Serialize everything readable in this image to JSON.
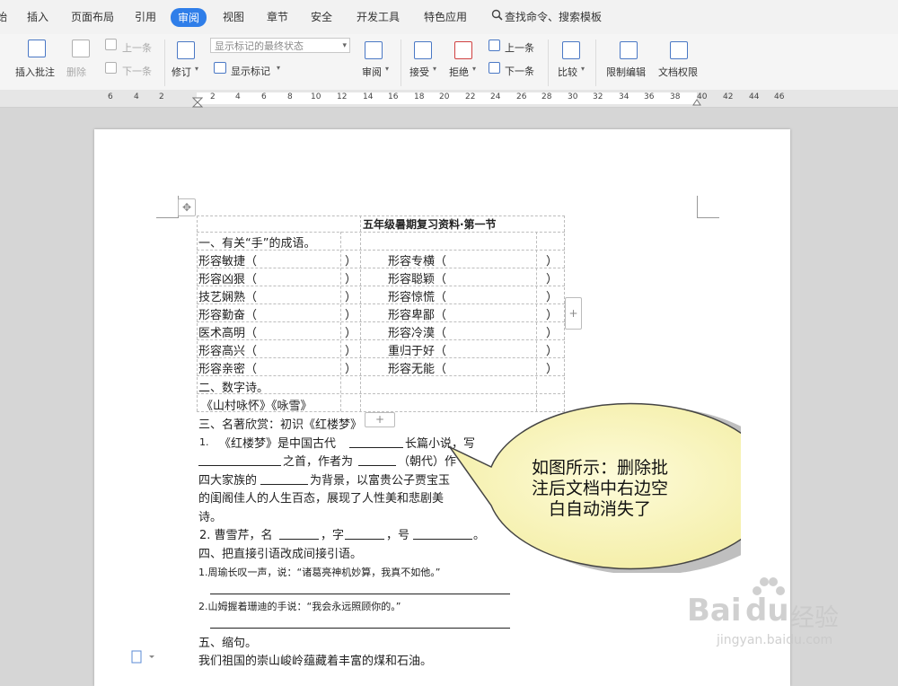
{
  "menu": {
    "partial": "始",
    "items": [
      "插入",
      "页面布局",
      "引用",
      "审阅",
      "视图",
      "章节",
      "安全",
      "开发工具",
      "特色应用"
    ],
    "active": "审阅",
    "search": "查找命令、搜索模板"
  },
  "toolbar": {
    "insert_comment": "插入批注",
    "delete": "删除",
    "prev": "上一条",
    "next": "下一条",
    "revise": "修订",
    "markup_state": "显示标记的最终状态",
    "show_markup": "显示标记",
    "review": "审阅",
    "accept": "接受",
    "reject": "拒绝",
    "prev2": "上一条",
    "next2": "下一条",
    "compare": "比较",
    "restrict_edit": "限制编辑",
    "doc_permission": "文档权限"
  },
  "ruler": {
    "ticks": [
      "6",
      "4",
      "2",
      "2",
      "4",
      "6",
      "8",
      "10",
      "12",
      "14",
      "16",
      "18",
      "20",
      "22",
      "24",
      "26",
      "28",
      "30",
      "32",
      "34",
      "36",
      "38",
      "40",
      "42",
      "44",
      "46"
    ]
  },
  "doc": {
    "title": "五年级暑期复习资料·第一节",
    "sec1": "一、有关“手”的成语。",
    "left_items": [
      "形容敏捷（",
      "形容凶狠（",
      "技艺娴熟（",
      "形容勤奋（",
      "医术高明（",
      "形容高兴（",
      "形容亲密（"
    ],
    "right_items": [
      "形容专横（",
      "形容聪颖（",
      "形容惊慌（",
      "形容卑鄙（",
      "形容冷漠（",
      "重归于好（",
      "形容无能（"
    ],
    "paren": "）",
    "sec2": "二、数字诗。",
    "poems": "《山村咏怀》《咏雪》",
    "sec3": "三、名著欣赏：初识《红楼梦》",
    "q1_num": "1.",
    "q1_a": "《红楼梦》是中国古代",
    "q1_b": "长篇小说，写",
    "q1_c": "之首，作者为",
    "q1_d": "（朝代）作",
    "q1_e": "四大家族的",
    "q1_f": "为背景，以富贵公子贾宝玉",
    "q1_g": "的闺阁佳人的人生百态，展现了人性美和悲剧美",
    "q1_h": "诗。",
    "q2": "2.  曹雪芹，名",
    "q2_b": "，字",
    "q2_c": "，号",
    "q2_d": "。",
    "sec4": "四、把直接引语改成间接引语。",
    "s4_1": "1.周瑜长叹一声，说：“诸葛亮神机妙算，我真不如他。”",
    "s4_2": "2.山姆握着珊迪的手说：“我会永远照顾你的。”",
    "sec5": "五、缩句。",
    "s5_1": "我们祖国的崇山峻岭蕴藏着丰富的煤和石油。"
  },
  "callout": {
    "line1": "如图所示：删除批",
    "line2": "注后文档中右边空",
    "line3": "白自动消失了"
  },
  "watermark": {
    "brand": "Bai",
    "brand2": "du",
    "brand3": "经验",
    "url": "jingyan.baidu.com"
  },
  "colors": {
    "accent": "#2f7ee9",
    "callout_fill": "#fbf7c4"
  }
}
